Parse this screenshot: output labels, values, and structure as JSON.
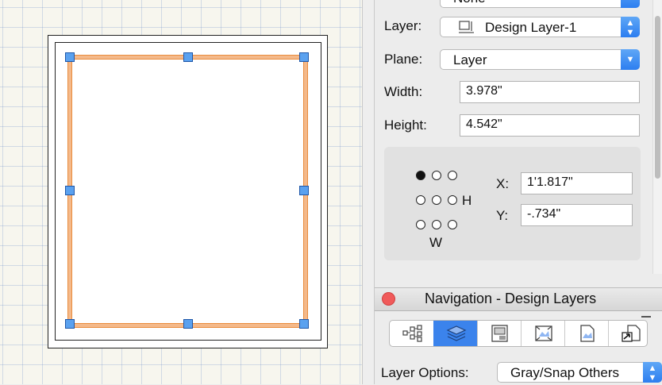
{
  "object_info": {
    "class_value_partial": "None",
    "layer_label": "Layer:",
    "layer_value": "Design Layer-1",
    "plane_label": "Plane:",
    "plane_value": "Layer",
    "width_label": "Width:",
    "width_value": "3.978\"",
    "height_label": "Height:",
    "height_value": "4.542\"",
    "x_label": "X:",
    "x_value": "1'1.817\"",
    "y_label": "Y:",
    "y_value": "-.734\"",
    "h_label": "H",
    "w_label": "W"
  },
  "navigation": {
    "title": "Navigation - Design Layers",
    "tools": [
      "classes-icon",
      "design-layers-icon",
      "sheet-layers-icon",
      "viewports-icon",
      "saved-views-icon",
      "references-icon"
    ],
    "active_tool": "design-layers-icon",
    "layer_options_label": "Layer Options:",
    "layer_options_value": "Gray/Snap Others"
  },
  "colors": {
    "accent_blue": "#2c7ef0",
    "selection_handle": "#5aa1ef",
    "shape_stroke": "#e98c3e",
    "close_button": "#f05a5a"
  }
}
